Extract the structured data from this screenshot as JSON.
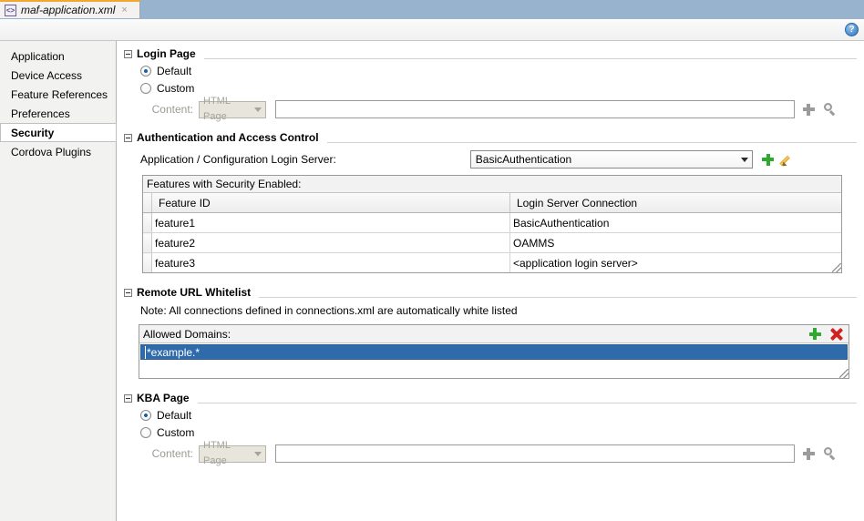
{
  "tab": {
    "title": "maf-application.xml",
    "close_label": "×",
    "icon": "xml-file-icon",
    "icon_glyph": "<>"
  },
  "toolbar": {
    "help_label": "?"
  },
  "sidebar": {
    "items": [
      {
        "label": "Application",
        "selected": false
      },
      {
        "label": "Device Access",
        "selected": false
      },
      {
        "label": "Feature References",
        "selected": false
      },
      {
        "label": "Preferences",
        "selected": false
      },
      {
        "label": "Security",
        "selected": true
      },
      {
        "label": "Cordova Plugins",
        "selected": false
      }
    ]
  },
  "login_page": {
    "section_title": "Login Page",
    "default_label": "Default",
    "custom_label": "Custom",
    "default_selected": true,
    "custom_selected": false,
    "content_label": "Content:",
    "content_type": "HTML Page",
    "content_value": "",
    "add_icon": "plus-icon",
    "browse_icon": "magnifier-icon"
  },
  "auth": {
    "section_title": "Authentication and Access Control",
    "login_server_label": "Application / Configuration Login Server:",
    "login_server_value": "BasicAuthentication",
    "add_icon": "plus-icon",
    "edit_icon": "pencil-icon",
    "table_caption": "Features with Security Enabled:",
    "columns": [
      "Feature ID",
      "Login Server Connection"
    ],
    "rows": [
      {
        "feature_id": "feature1",
        "login_server": "BasicAuthentication"
      },
      {
        "feature_id": "feature2",
        "login_server": "OAMMS"
      },
      {
        "feature_id": "feature3",
        "login_server": "<application login server>"
      }
    ]
  },
  "whitelist": {
    "section_title": "Remote URL Whitelist",
    "note": "Note: All connections defined in connections.xml are automatically white listed",
    "caption": "Allowed Domains:",
    "add_icon": "plus-icon",
    "remove_icon": "red-x-icon",
    "entries": [
      "*example.*"
    ],
    "selected_entry": "*example.*"
  },
  "kba_page": {
    "section_title": "KBA Page",
    "default_label": "Default",
    "custom_label": "Custom",
    "default_selected": true,
    "custom_selected": false,
    "content_label": "Content:",
    "content_type": "HTML Page",
    "content_value": "",
    "add_icon": "plus-icon",
    "browse_icon": "magnifier-icon"
  },
  "colors": {
    "tabbar_blue": "#97b3ce",
    "tab_accent_orange": "#f0a830",
    "selection_blue": "#2f6bab",
    "icon_green": "#2faa2f",
    "icon_red": "#d02020",
    "icon_orange": "#e8a020",
    "disabled_text": "#a6a49a"
  }
}
